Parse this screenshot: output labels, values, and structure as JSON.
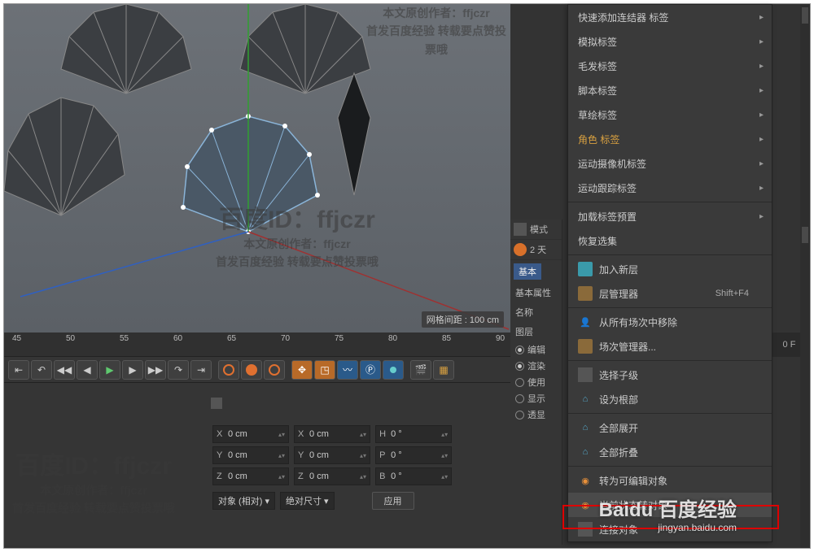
{
  "viewport": {
    "grid_info": "网格间距 : 100 cm"
  },
  "watermark": {
    "title": "百度ID：ffjczr",
    "author_line": "本文原创作者：ffjczr",
    "source_line": "首发百度经验 转载要点赞投票哦"
  },
  "timeline": {
    "ticks": [
      "45",
      "50",
      "55",
      "60",
      "65",
      "70",
      "75",
      "80",
      "85",
      "90"
    ],
    "current": "0 F"
  },
  "coords": {
    "rows": [
      {
        "a_lbl": "X",
        "a_val": "0 cm",
        "b_lbl": "X",
        "b_val": "0 cm",
        "c_lbl": "H",
        "c_val": "0 °"
      },
      {
        "a_lbl": "Y",
        "a_val": "0 cm",
        "b_lbl": "Y",
        "b_val": "0 cm",
        "c_lbl": "P",
        "c_val": "0 °"
      },
      {
        "a_lbl": "Z",
        "a_val": "0 cm",
        "b_lbl": "Z",
        "b_val": "0 cm",
        "c_lbl": "B",
        "c_val": "0 °"
      }
    ],
    "mode1": "对象 (相对)",
    "mode2": "绝对尺寸",
    "apply": "应用"
  },
  "attributes": {
    "mode_label": "模式",
    "two_label": "2 天",
    "basic_tab": "基本",
    "basic_attr": "基本属性",
    "name_label": "名称",
    "layer_label": "图层",
    "radios": [
      "编辑",
      "渲染",
      "使用",
      "显示",
      "透显"
    ]
  },
  "context_menu": {
    "items": [
      {
        "label": "快速添加连结器 标签",
        "arrow": true
      },
      {
        "label": "模拟标签",
        "arrow": true
      },
      {
        "label": "毛发标签",
        "arrow": true
      },
      {
        "label": "脚本标签",
        "arrow": true
      },
      {
        "label": "草绘标签",
        "arrow": true
      },
      {
        "label": "角色 标签",
        "highlight": true,
        "arrow": true
      },
      {
        "label": "运动摄像机标签",
        "arrow": true
      },
      {
        "label": "运动跟踪标签",
        "arrow": true
      }
    ],
    "items2": [
      {
        "label": "加载标签预置",
        "arrow": true
      },
      {
        "label": "恢复选集"
      }
    ],
    "items3": [
      {
        "icon": "cyan",
        "label": "加入新层"
      },
      {
        "icon": "brown",
        "label": "层管理器",
        "shortcut": "Shift+F4"
      }
    ],
    "items4": [
      {
        "icon": "person",
        "label": "从所有场次中移除"
      },
      {
        "icon": "brown",
        "label": "场次管理器..."
      }
    ],
    "items5": [
      {
        "icon": "sq",
        "label": "选择子级"
      },
      {
        "icon": "hier",
        "label": "设为根部"
      }
    ],
    "items6": [
      {
        "icon": "hier",
        "label": "全部展开"
      },
      {
        "icon": "hier",
        "label": "全部折叠"
      }
    ],
    "items7": [
      {
        "icon": "orange",
        "label": "转为可编辑对象"
      },
      {
        "icon": "orange",
        "label": "当前状态转对象",
        "selected": true
      },
      {
        "icon": "sq",
        "label": "连接对象"
      }
    ]
  },
  "baidu_watermark": {
    "main": "Baidu 百度经验",
    "sub": "jingyan.baidu.com"
  }
}
